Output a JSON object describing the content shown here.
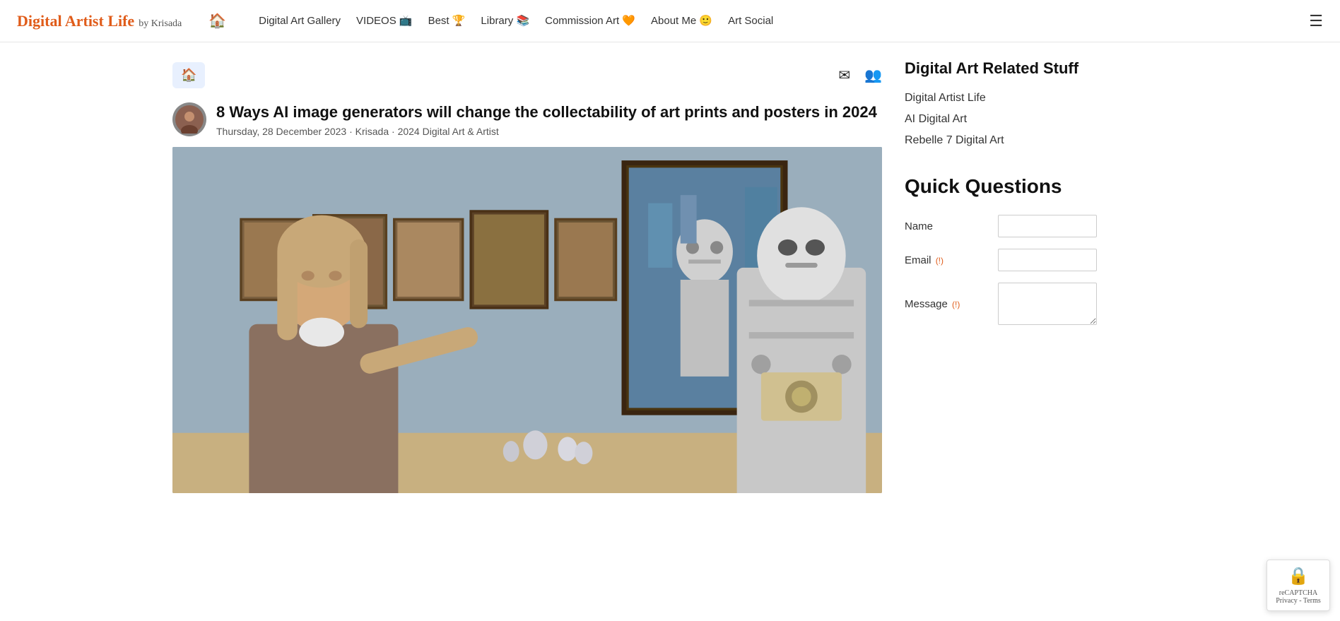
{
  "site": {
    "logo_main": "Digital Artist Life",
    "logo_sub": "by Krisada",
    "accent_color": "#e05c1a"
  },
  "nav": {
    "home_icon": "🏠",
    "links": [
      {
        "label": "Digital Art Gallery",
        "id": "digital-art-gallery"
      },
      {
        "label": "VIDEOS 📺",
        "id": "videos"
      },
      {
        "label": "Best 🏆",
        "id": "best"
      },
      {
        "label": "Library 📚",
        "id": "library"
      },
      {
        "label": "Commission Art 🧡",
        "id": "commission-art"
      },
      {
        "label": "About Me 🙂",
        "id": "about-me"
      },
      {
        "label": "Art Social",
        "id": "art-social"
      }
    ],
    "hamburger": "☰"
  },
  "toolbar": {
    "home_btn": "🏠",
    "email_icon": "✉",
    "users_icon": "👥"
  },
  "article": {
    "title": "8 Ways AI image generators will change the collectability of art prints and posters in 2024",
    "date": "Thursday, 28 December 2023",
    "author": "Krisada",
    "category": "2024 Digital Art & Artist",
    "meta_separator": "·"
  },
  "sidebar": {
    "related_title": "Digital Art Related Stuff",
    "related_links": [
      {
        "label": "Digital Artist Life"
      },
      {
        "label": "AI Digital Art"
      },
      {
        "label": "Rebelle 7 Digital Art"
      }
    ],
    "quick_questions_title": "Quick Questions",
    "form": {
      "name_label": "Name",
      "email_label": "Email",
      "email_required": "(!)",
      "message_label": "Message",
      "message_required": "(!)"
    }
  },
  "recaptcha": {
    "text": "reCAPTCHA\nPrivacy - Terms"
  }
}
